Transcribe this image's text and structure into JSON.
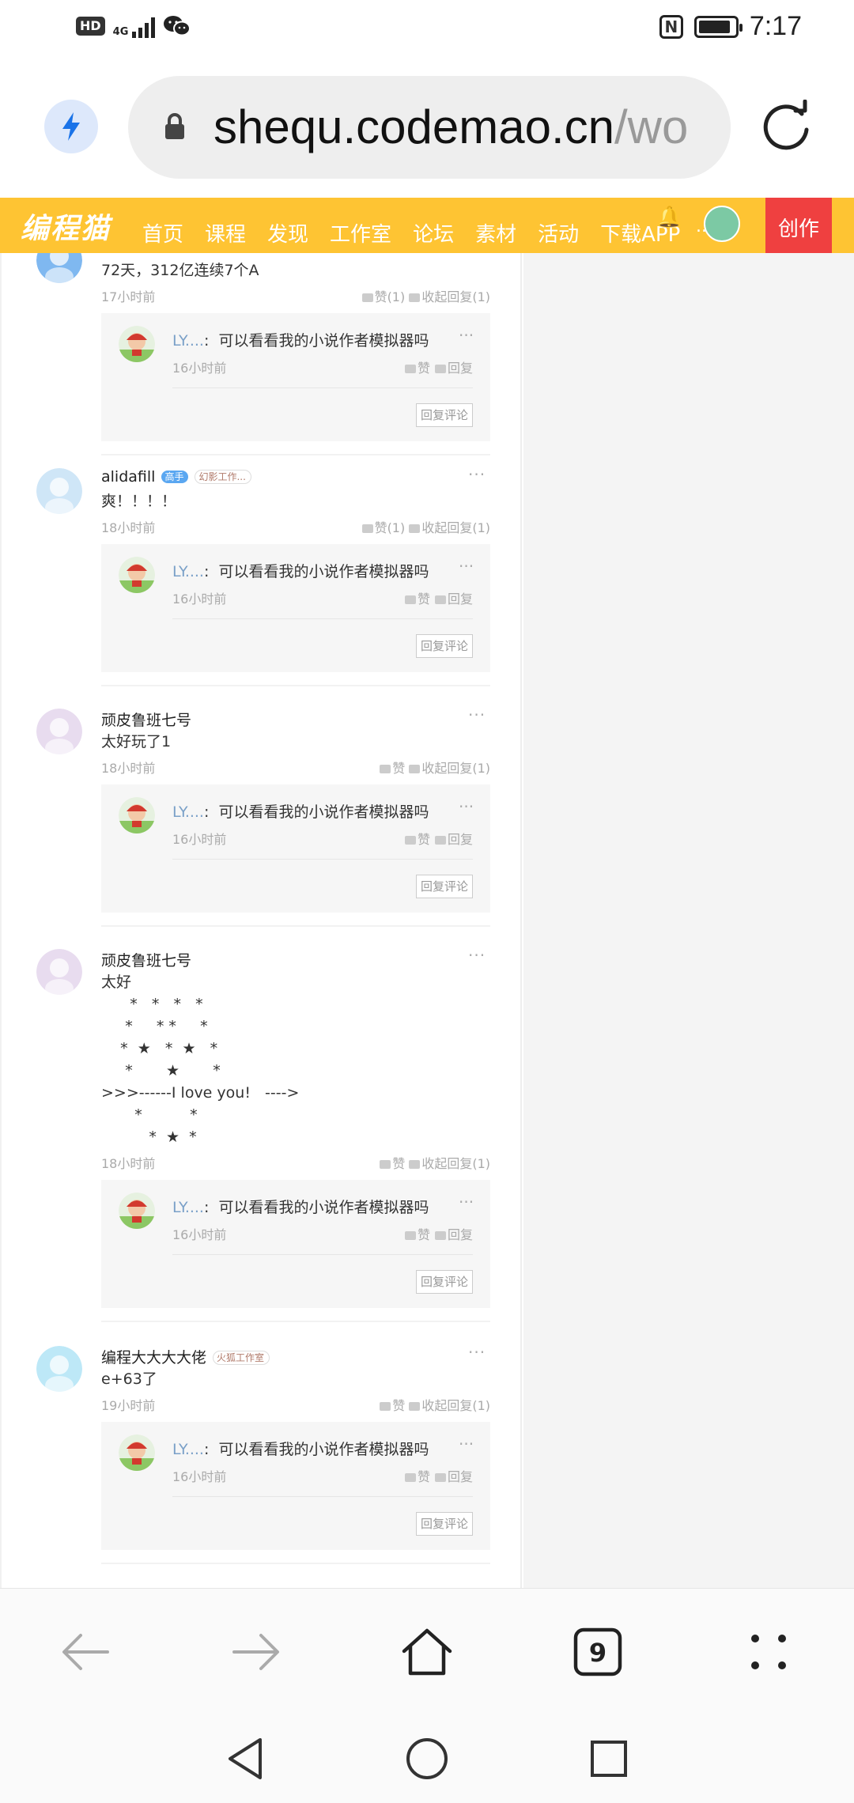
{
  "status_bar": {
    "hd_label": "HD",
    "network_label": "4G",
    "time": "7:17",
    "battery_level": 0.9
  },
  "address_bar": {
    "url_main": "shequ.codemao.cn",
    "url_rest": "/wo"
  },
  "site_nav": {
    "logo": "编程猫",
    "items": [
      "首页",
      "课程",
      "发现",
      "工作室",
      "论坛",
      "素材",
      "活动",
      "下载APP"
    ],
    "more": "...",
    "create_label": "创作"
  },
  "comments": [
    {
      "name": "",
      "badges": [],
      "text": "72天，312亿连续7个A",
      "time": "17小时前",
      "like_label": "赞(1)",
      "reply_label": "收起回复(1)",
      "reply": {
        "user": "LY....",
        "text": "可以看看我的小说作者模拟器吗",
        "time": "16小时前",
        "like_label": "赞",
        "reply_label": "回复",
        "button": "回复评论"
      }
    },
    {
      "name": "alidafill",
      "badges": [
        {
          "text": "高手",
          "style": "blue"
        },
        {
          "text": "幻影工作...",
          "style": "outline"
        }
      ],
      "text": "爽！！！！",
      "time": "18小时前",
      "like_label": "赞(1)",
      "reply_label": "收起回复(1)",
      "reply": {
        "user": "LY....",
        "text": "可以看看我的小说作者模拟器吗",
        "time": "16小时前",
        "like_label": "赞",
        "reply_label": "回复",
        "button": "回复评论"
      }
    },
    {
      "name": "顽皮鲁班七号",
      "badges": [],
      "text": "太好玩了1",
      "time": "18小时前",
      "like_label": "赞",
      "reply_label": "收起回复(1)",
      "reply": {
        "user": "LY....",
        "text": "可以看看我的小说作者模拟器吗",
        "time": "16小时前",
        "like_label": "赞",
        "reply_label": "回复",
        "button": "回复评论"
      }
    },
    {
      "name": "顽皮鲁班七号",
      "badges": [],
      "text": "太好\n      *   *   *   *\n     *     * *     *\n    *  ★   *  ★   *\n     *       ★       *\n>>>------I love you!   ---->\n       *          *\n          *  ★  *",
      "time": "18小时前",
      "like_label": "赞",
      "reply_label": "收起回复(1)",
      "reply": {
        "user": "LY....",
        "text": "可以看看我的小说作者模拟器吗",
        "time": "16小时前",
        "like_label": "赞",
        "reply_label": "回复",
        "button": "回复评论"
      }
    },
    {
      "name": "编程大大大大佬",
      "badges": [
        {
          "text": "火狐工作室",
          "style": "outline"
        }
      ],
      "text": "e+63了",
      "time": "19小时前",
      "like_label": "赞",
      "reply_label": "收起回复(1)",
      "reply": {
        "user": "LY....",
        "text": "可以看看我的小说作者模拟器吗",
        "time": "16小时前",
        "like_label": "赞",
        "reply_label": "回复",
        "button": "回复评论"
      }
    }
  ],
  "browser_bar": {
    "tab_count": "9"
  },
  "colors": {
    "nav_bg": "#fec433",
    "create_bg": "#ef4040",
    "accent_blue": "#1a73e8"
  }
}
